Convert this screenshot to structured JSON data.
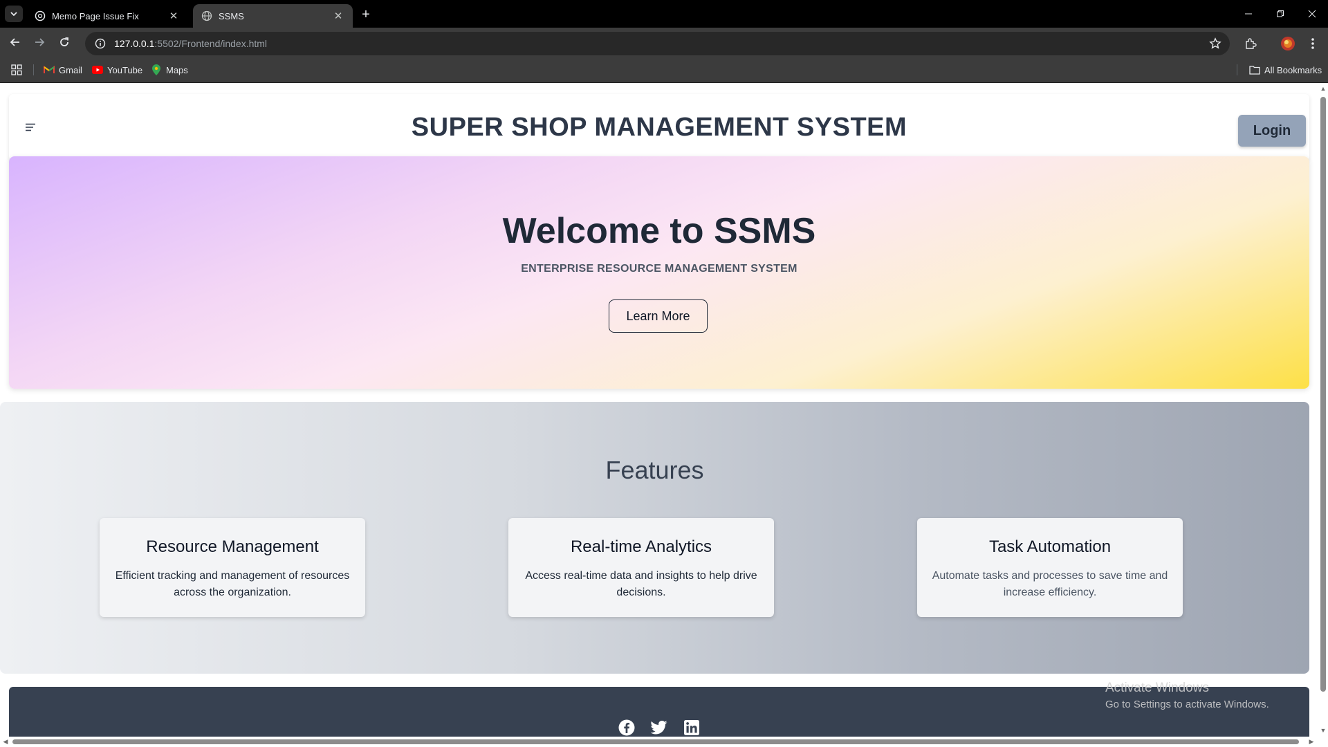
{
  "browser": {
    "tabs": [
      {
        "title": "Memo Page Issue Fix",
        "active": false
      },
      {
        "title": "SSMS",
        "active": true
      }
    ],
    "url_host": "127.0.0.1",
    "url_path": ":5502/Frontend/index.html",
    "bookmarks": [
      {
        "label": "Gmail",
        "icon": "gmail-icon"
      },
      {
        "label": "YouTube",
        "icon": "youtube-icon"
      },
      {
        "label": "Maps",
        "icon": "maps-icon"
      }
    ],
    "all_bookmarks": "All Bookmarks"
  },
  "header": {
    "title": "SUPER SHOP MANAGEMENT SYSTEM",
    "login_label": "Login"
  },
  "hero": {
    "title": "Welcome to SSMS",
    "subtitle": "ENTERPRISE RESOURCE MANAGEMENT SYSTEM",
    "button_label": "Learn More"
  },
  "features": {
    "title": "Features",
    "cards": [
      {
        "title": "Resource Management",
        "text": "Efficient tracking and management of resources across the organization."
      },
      {
        "title": "Real-time Analytics",
        "text": "Access real-time data and insights to help drive decisions."
      },
      {
        "title": "Task Automation",
        "text": "Automate tasks and processes to save time and increase efficiency."
      }
    ]
  },
  "footer": {
    "social": [
      "facebook-icon",
      "twitter-icon",
      "linkedin-icon"
    ]
  },
  "watermark": {
    "line1": "Activate Windows",
    "line2": "Go to Settings to activate Windows."
  },
  "colors": {
    "header_text": "#2d3748",
    "login_bg": "#94a3b8",
    "footer_bg": "#374151"
  }
}
